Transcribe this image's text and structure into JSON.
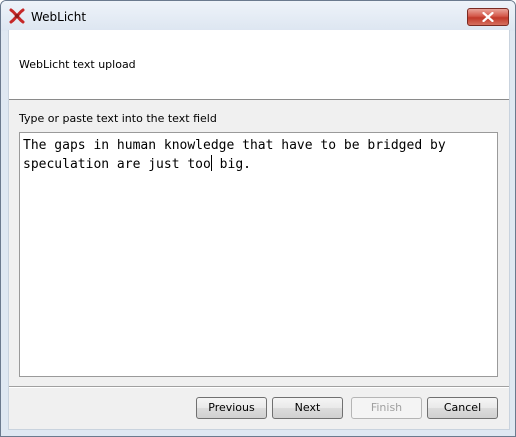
{
  "window": {
    "title": "WebLicht",
    "app_icon": "weblicht-logo-icon",
    "close_icon": "close-icon",
    "accent_close_color": "#c7402f"
  },
  "header": {
    "title": "WebLicht text upload"
  },
  "main": {
    "instruction": "Type or paste text into the text field",
    "text_before_caret": "The gaps in human knowledge that have to be bridged by\nspeculation are just too",
    "text_after_caret": " big."
  },
  "buttons": {
    "previous": "Previous",
    "next": "Next",
    "finish": "Finish",
    "cancel": "Cancel",
    "finish_enabled": false
  }
}
